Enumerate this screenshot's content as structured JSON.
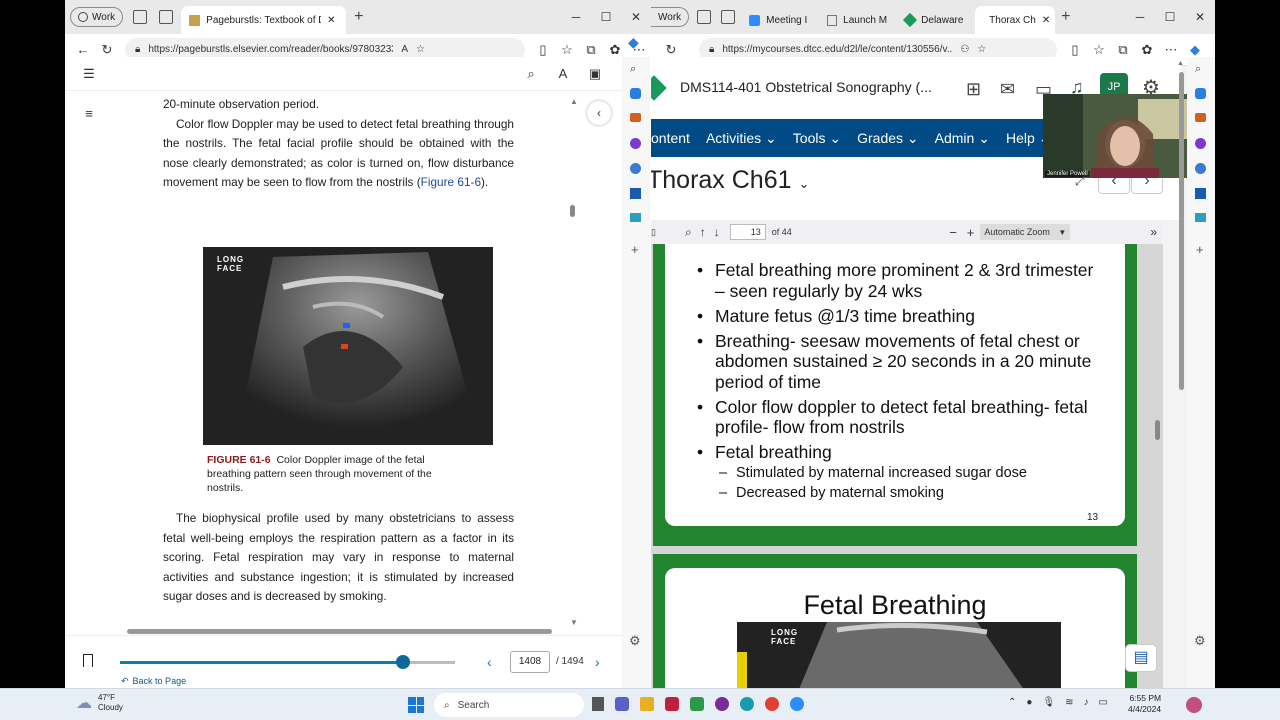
{
  "left_window": {
    "profile": "Work",
    "tab_title": "Pageburstls: Textbook of Diagno",
    "url": "https://pageburstls.elsevier.com/reader/books/97803233...",
    "reader": {
      "para1_lead": "20-minute observation period.",
      "para2_start": "Color flow Doppler may be used to detect fetal breathing through the nostrils. The fetal facial profile should be obtained with the nose clearly demonstrated; as color is turned on, flow disturbance movement may be seen to flow from the nostrils (",
      "para2_link": "Figure 61-6",
      "para2_end": ").",
      "figure_label": "LONG\nFACE",
      "figure_caption_id": "FIGURE 61-6",
      "figure_caption_text": "Color Doppler image of the fetal breathing pattern seen through movement of the nostrils.",
      "para3": "The biophysical profile used by many obstetricians to assess fetal well-being employs the respiration pattern as a factor in its scoring. Fetal respiration may vary in response to maternal activities and substance ingestion; it is stimulated by increased sugar doses and is decreased by smoking.",
      "back_to_page": "Back to Page",
      "page_current": "1408",
      "page_total": "/ 1494",
      "slider_fraction": 0.94
    }
  },
  "right_window": {
    "profile": "Work",
    "tabs": [
      "Meeting I",
      "Launch M",
      "Delaware",
      "Thorax Ch"
    ],
    "url": "https://mycourses.dtcc.edu/d2l/le/content/130556/v...",
    "course_title": "DMS114-401 Obstetrical Sonography (...",
    "user_initials": "JP",
    "nav": [
      "ontent",
      "Activities ⌄",
      "Tools ⌄",
      "Grades ⌄",
      "Admin ⌄",
      "Help ⌄"
    ],
    "module_title": "Thorax Ch61",
    "video_name": "Jennifer Powell",
    "pdf": {
      "page": "13",
      "of": "of 44",
      "zoom": "Automatic Zoom"
    },
    "slide1": {
      "bullets": [
        "Fetal breathing more prominent 2 & 3rd trimester – seen regularly by 24 wks",
        "Mature fetus @1/3 time breathing",
        "Breathing- seesaw movements of fetal chest or abdomen sustained ≥ 20 seconds in a 20 minute period of time",
        "Color flow doppler to detect fetal breathing- fetal profile- flow from nostrils",
        "Fetal breathing"
      ],
      "subbullets": [
        "Stimulated by maternal increased sugar dose",
        "Decreased by maternal smoking"
      ],
      "page_number": "13"
    },
    "slide2": {
      "title": "Fetal Breathing",
      "image_label": "LONG\nFACE"
    }
  },
  "taskbar": {
    "weather_temp": "47°F",
    "weather_desc": "Cloudy",
    "search": "Search",
    "time": "6:55 PM",
    "date": "4/4/2024"
  },
  "colors": {
    "d2l_nav": "#004a85",
    "slide_green": "#21842f",
    "reader_accent": "#0a7fa8",
    "caption_red": "#8a1a1a"
  }
}
